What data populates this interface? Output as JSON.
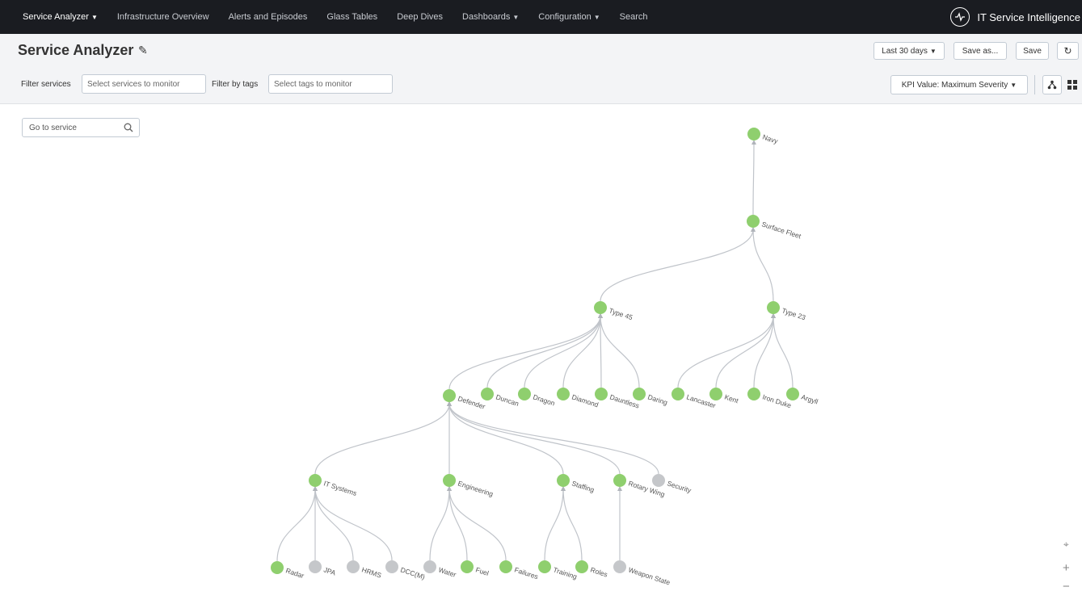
{
  "nav": {
    "items": [
      {
        "label": "Service Analyzer",
        "dropdown": true
      },
      {
        "label": "Infrastructure Overview",
        "dropdown": false
      },
      {
        "label": "Alerts and Episodes",
        "dropdown": false
      },
      {
        "label": "Glass Tables",
        "dropdown": false
      },
      {
        "label": "Deep Dives",
        "dropdown": false
      },
      {
        "label": "Dashboards",
        "dropdown": true
      },
      {
        "label": "Configuration",
        "dropdown": true
      },
      {
        "label": "Search",
        "dropdown": false
      }
    ],
    "brand": "IT Service Intelligence",
    "brand_icon": "heartbeat-icon"
  },
  "header": {
    "title": "Service Analyzer",
    "time_range": "Last 30 days",
    "save_as": "Save as...",
    "save": "Save",
    "filter_services_label": "Filter services",
    "filter_services_placeholder": "Select services to monitor",
    "filter_tags_label": "Filter by tags",
    "filter_tags_placeholder": "Select tags to monitor",
    "kpi_value": "KPI Value: Maximum Severity"
  },
  "canvas": {
    "goto_placeholder": "Go to service",
    "zoom_in": "+",
    "zoom_out": "−"
  },
  "colors": {
    "healthy": "#8fcf6e",
    "inactive": "#c5c7ca",
    "topnav": "#1a1c21",
    "edge": "#c0c4ca"
  },
  "graph": {
    "nodes": [
      {
        "id": "navy",
        "label": "Navy",
        "status": "healthy"
      },
      {
        "id": "surface-fleet",
        "label": "Surface Fleet",
        "status": "healthy"
      },
      {
        "id": "type-45",
        "label": "Type 45",
        "status": "healthy"
      },
      {
        "id": "type-23",
        "label": "Type 23",
        "status": "healthy"
      },
      {
        "id": "defender",
        "label": "Defender",
        "status": "healthy"
      },
      {
        "id": "duncan",
        "label": "Duncan",
        "status": "healthy"
      },
      {
        "id": "dragon",
        "label": "Dragon",
        "status": "healthy"
      },
      {
        "id": "diamond",
        "label": "Diamond",
        "status": "healthy"
      },
      {
        "id": "dauntless",
        "label": "Dauntless",
        "status": "healthy"
      },
      {
        "id": "daring",
        "label": "Daring",
        "status": "healthy"
      },
      {
        "id": "lancaster",
        "label": "Lancaster",
        "status": "healthy"
      },
      {
        "id": "kent",
        "label": "Kent",
        "status": "healthy"
      },
      {
        "id": "iron-duke",
        "label": "Iron Duke",
        "status": "healthy"
      },
      {
        "id": "argyll",
        "label": "Argyll",
        "status": "healthy"
      },
      {
        "id": "it-systems",
        "label": "IT Systems",
        "status": "healthy"
      },
      {
        "id": "engineering",
        "label": "Engineering",
        "status": "healthy"
      },
      {
        "id": "staffing",
        "label": "Staffing",
        "status": "healthy"
      },
      {
        "id": "rotary-wing",
        "label": "Rotary Wing",
        "status": "healthy"
      },
      {
        "id": "security",
        "label": "Security",
        "status": "inactive"
      },
      {
        "id": "radar",
        "label": "Radar",
        "status": "healthy"
      },
      {
        "id": "jpa",
        "label": "JPA",
        "status": "inactive"
      },
      {
        "id": "hrms",
        "label": "HRMS",
        "status": "inactive"
      },
      {
        "id": "dccm",
        "label": "DCC(M)",
        "status": "inactive"
      },
      {
        "id": "water",
        "label": "Water",
        "status": "inactive"
      },
      {
        "id": "fuel",
        "label": "Fuel",
        "status": "healthy"
      },
      {
        "id": "failures",
        "label": "Failures",
        "status": "healthy"
      },
      {
        "id": "training",
        "label": "Training",
        "status": "healthy"
      },
      {
        "id": "roles",
        "label": "Roles",
        "status": "healthy"
      },
      {
        "id": "weapon-state",
        "label": "Weapon State",
        "status": "inactive"
      }
    ],
    "edges": [
      [
        "surface-fleet",
        "navy"
      ],
      [
        "type-45",
        "surface-fleet"
      ],
      [
        "type-23",
        "surface-fleet"
      ],
      [
        "defender",
        "type-45"
      ],
      [
        "duncan",
        "type-45"
      ],
      [
        "dragon",
        "type-45"
      ],
      [
        "diamond",
        "type-45"
      ],
      [
        "dauntless",
        "type-45"
      ],
      [
        "daring",
        "type-45"
      ],
      [
        "lancaster",
        "type-23"
      ],
      [
        "kent",
        "type-23"
      ],
      [
        "iron-duke",
        "type-23"
      ],
      [
        "argyll",
        "type-23"
      ],
      [
        "it-systems",
        "defender"
      ],
      [
        "engineering",
        "defender"
      ],
      [
        "staffing",
        "defender"
      ],
      [
        "rotary-wing",
        "defender"
      ],
      [
        "security",
        "defender"
      ],
      [
        "radar",
        "it-systems"
      ],
      [
        "jpa",
        "it-systems"
      ],
      [
        "hrms",
        "it-systems"
      ],
      [
        "dccm",
        "it-systems"
      ],
      [
        "water",
        "engineering"
      ],
      [
        "fuel",
        "engineering"
      ],
      [
        "failures",
        "engineering"
      ],
      [
        "training",
        "staffing"
      ],
      [
        "roles",
        "staffing"
      ],
      [
        "weapon-state",
        "rotary-wing"
      ]
    ]
  }
}
